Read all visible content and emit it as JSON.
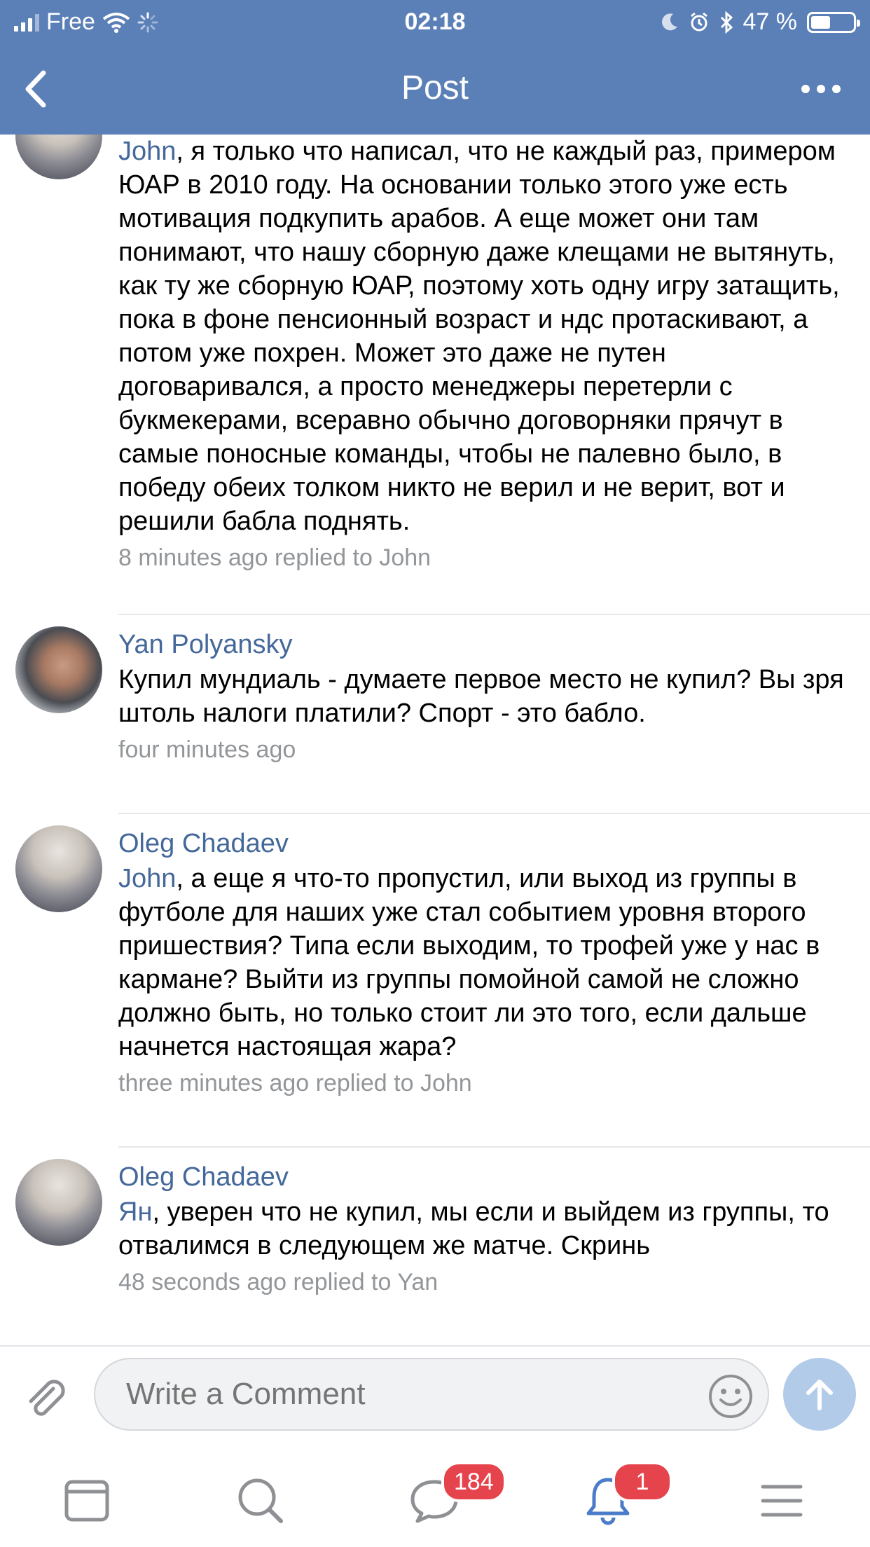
{
  "status_bar": {
    "carrier": "Free",
    "time": "02:18",
    "battery": "47 %",
    "battery_level": 0.47
  },
  "nav": {
    "title": "Post",
    "back_icon": "chevron-left-icon",
    "more_icon": "more-dots-icon"
  },
  "comments": [
    {
      "author": "",
      "mention": "John",
      "text": ", я только что написал, что не каждый раз, примером ЮАР в 2010 году. На основании только этого уже есть мотивация подкупить арабов. А еще может они там понимают, что нашу сборную даже клещами не вытянуть, как ту же сборную ЮАР, поэтому хоть одну игру затащить, пока в фоне пенсионный возраст и ндс протаскивают, а потом уже похрен. Может это даже не путен договаривался, а просто менеджеры перетерли с букмекерами, всеравно обычно договорняки прячут в самые поносные команды, чтобы не палевно было, в победу обеих толком никто не верил и не верит, вот и решили бабла поднять.",
      "time": "8 minutes ago",
      "reply": "replied to John"
    },
    {
      "author": "Yan Polyansky",
      "mention": "",
      "text": "Купил мундиаль - думаете первое место не купил? Вы зря штоль налоги платили? Спорт - это бабло.",
      "time": "four minutes ago",
      "reply": ""
    },
    {
      "author": "Oleg Chadaev",
      "mention": "John",
      "text": ", а еще я что-то пропустил, или выход из группы в футболе для наших уже стал событием уровня второго пришествия? Типа если выходим, то трофей уже у нас в кармане? Выйти из группы помойной самой не сложно должно быть, но только стоит ли это того, если дальше начнется настоящая жара?",
      "time": "three minutes ago",
      "reply": "replied to John"
    },
    {
      "author": "Oleg Chadaev",
      "mention": "Ян",
      "text": ", уверен что не купил, мы если и выйдем из группы, то отвалимся в следующем же матче. Скринь",
      "time": "48 seconds ago",
      "reply": "replied to Yan"
    }
  ],
  "composer": {
    "placeholder": "Write a Comment"
  },
  "tabbar": {
    "messages_badge": "184",
    "notifications_badge": "1"
  },
  "colors": {
    "header": "#5b7fb7",
    "link": "#44689a",
    "meta": "#939699",
    "badge": "#e6444c",
    "send": "#b2cbe9"
  }
}
